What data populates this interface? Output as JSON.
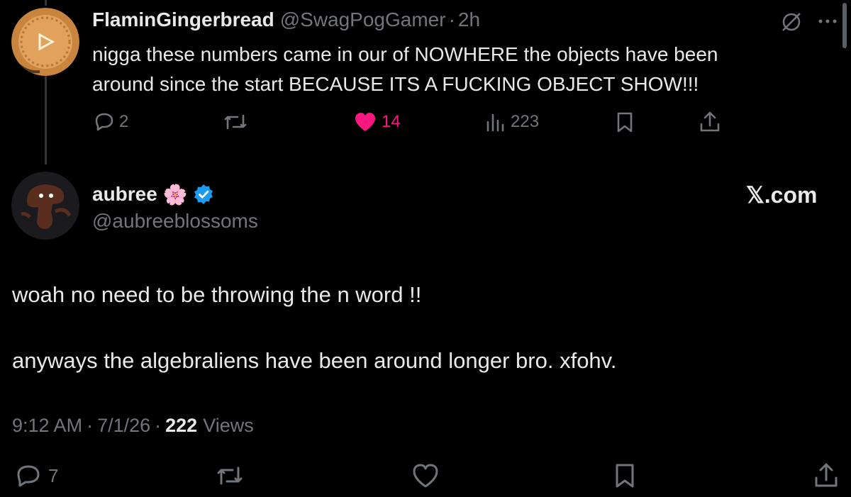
{
  "parent_tweet": {
    "display_name": "FlaminGingerbread",
    "handle": "@SwagPogGamer",
    "separator": "·",
    "time": "2h",
    "text_line1": "nigga these numbers came in our of NOWHERE the objects have been",
    "text_line2": "around since the start BECAUSE ITS A FUCKING OBJECT SHOW!!!",
    "actions": {
      "replies": "2",
      "likes": "14",
      "views": "223"
    }
  },
  "main_tweet": {
    "display_name": "aubree",
    "name_emoji": "🌸",
    "handle": "@aubreeblossoms",
    "watermark": "𝕏.com",
    "text_para1": "woah no need to be throwing the n word !!",
    "text_para2": "anyways the algebraliens have been around longer bro. xfohv.",
    "meta": {
      "time": "9:12 AM",
      "sep1": "·",
      "date": "7/1/26",
      "sep2": "·",
      "views_count": "222",
      "views_label": "Views"
    },
    "actions": {
      "replies": "7"
    }
  },
  "colors": {
    "background": "#000000",
    "text": "#e7e9ea",
    "muted": "#71767b",
    "like_active": "#f91880",
    "verified": "#1d9bf0"
  },
  "icons": [
    "slash-circle-icon",
    "more-icon",
    "reply-icon",
    "retweet-icon",
    "heart-filled-icon",
    "views-icon",
    "bookmark-icon",
    "share-icon",
    "verified-badge-icon",
    "heart-outline-icon"
  ]
}
